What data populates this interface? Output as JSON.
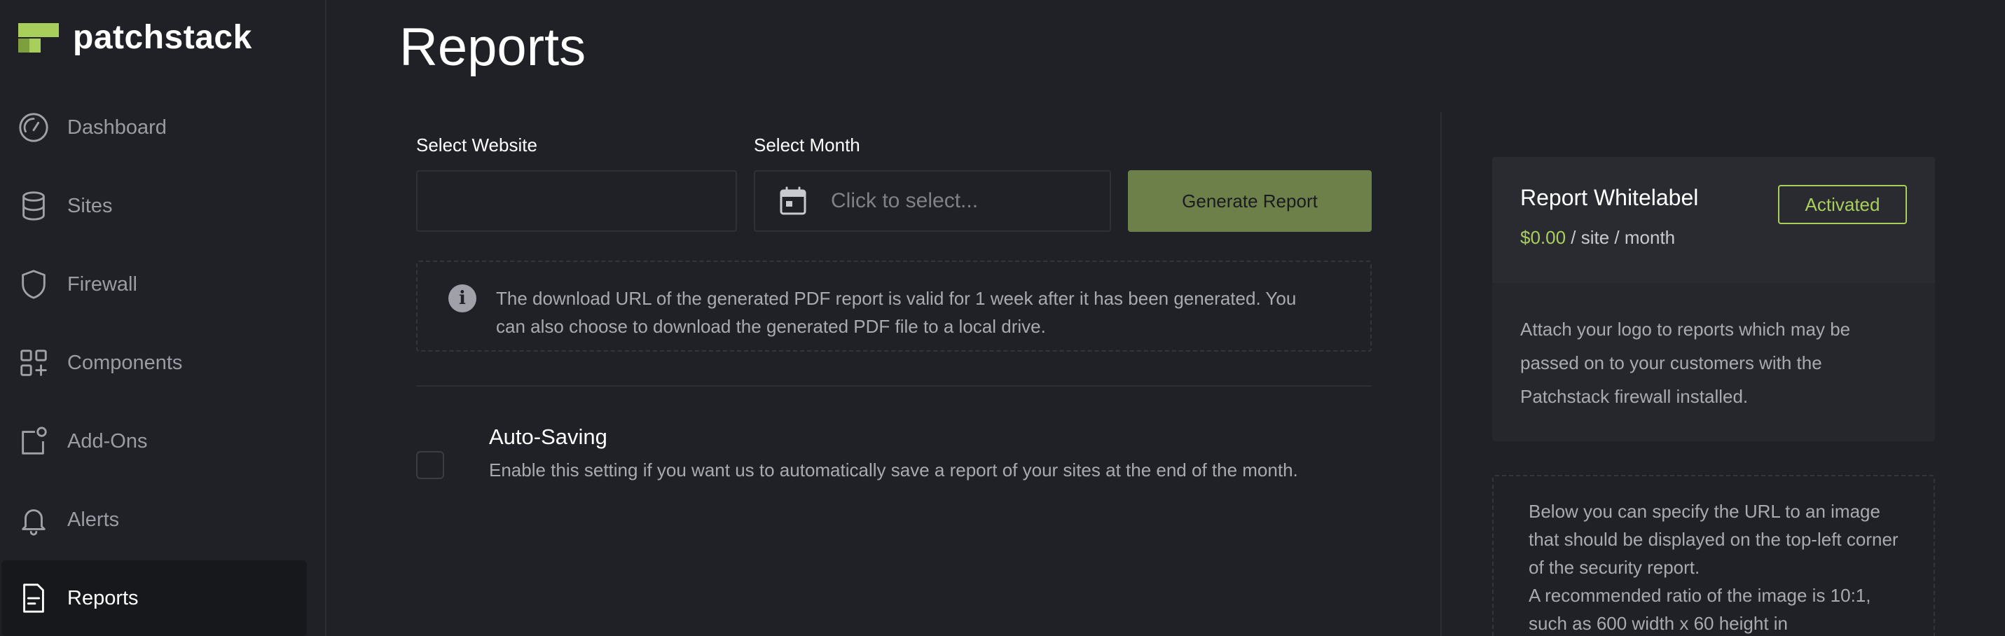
{
  "brand": {
    "name": "patchstack",
    "accent": "#a8cf5c"
  },
  "sidebar": {
    "items": [
      {
        "label": "Dashboard",
        "icon": "dashboard-gauge-icon",
        "active": false
      },
      {
        "label": "Sites",
        "icon": "database-icon",
        "active": false
      },
      {
        "label": "Firewall",
        "icon": "shield-icon",
        "active": false
      },
      {
        "label": "Components",
        "icon": "components-grid-icon",
        "active": false
      },
      {
        "label": "Add-Ons",
        "icon": "add-ons-icon",
        "active": false
      },
      {
        "label": "Alerts",
        "icon": "bell-icon",
        "active": false
      },
      {
        "label": "Reports",
        "icon": "document-icon",
        "active": true
      }
    ]
  },
  "main": {
    "title": "Reports",
    "select_website": {
      "label": "Select Website",
      "value": ""
    },
    "select_month": {
      "label": "Select Month",
      "placeholder": "Click to select..."
    },
    "generate_button": "Generate Report",
    "info_text": "The download URL of the generated PDF report is valid for 1 week after it has been generated. You can also choose to download the generated PDF file to a local drive.",
    "auto_saving": {
      "title": "Auto-Saving",
      "description": "Enable this setting if you want us to automatically save a report of your sites at the end of the month.",
      "checked": false
    }
  },
  "whitelabel": {
    "title": "Report Whitelabel",
    "badge": "Activated",
    "price_amount": "$0.00",
    "price_unit": " / site / month",
    "description": "Attach your logo to reports which may be passed on to your customers with the Patchstack firewall installed.",
    "url_help_1": "Below you can specify the URL to an image that should be displayed on the top-left corner of the security report.",
    "url_help_2": "A recommended ratio of the image is 10:1, such as 600 width x 60 height in"
  }
}
